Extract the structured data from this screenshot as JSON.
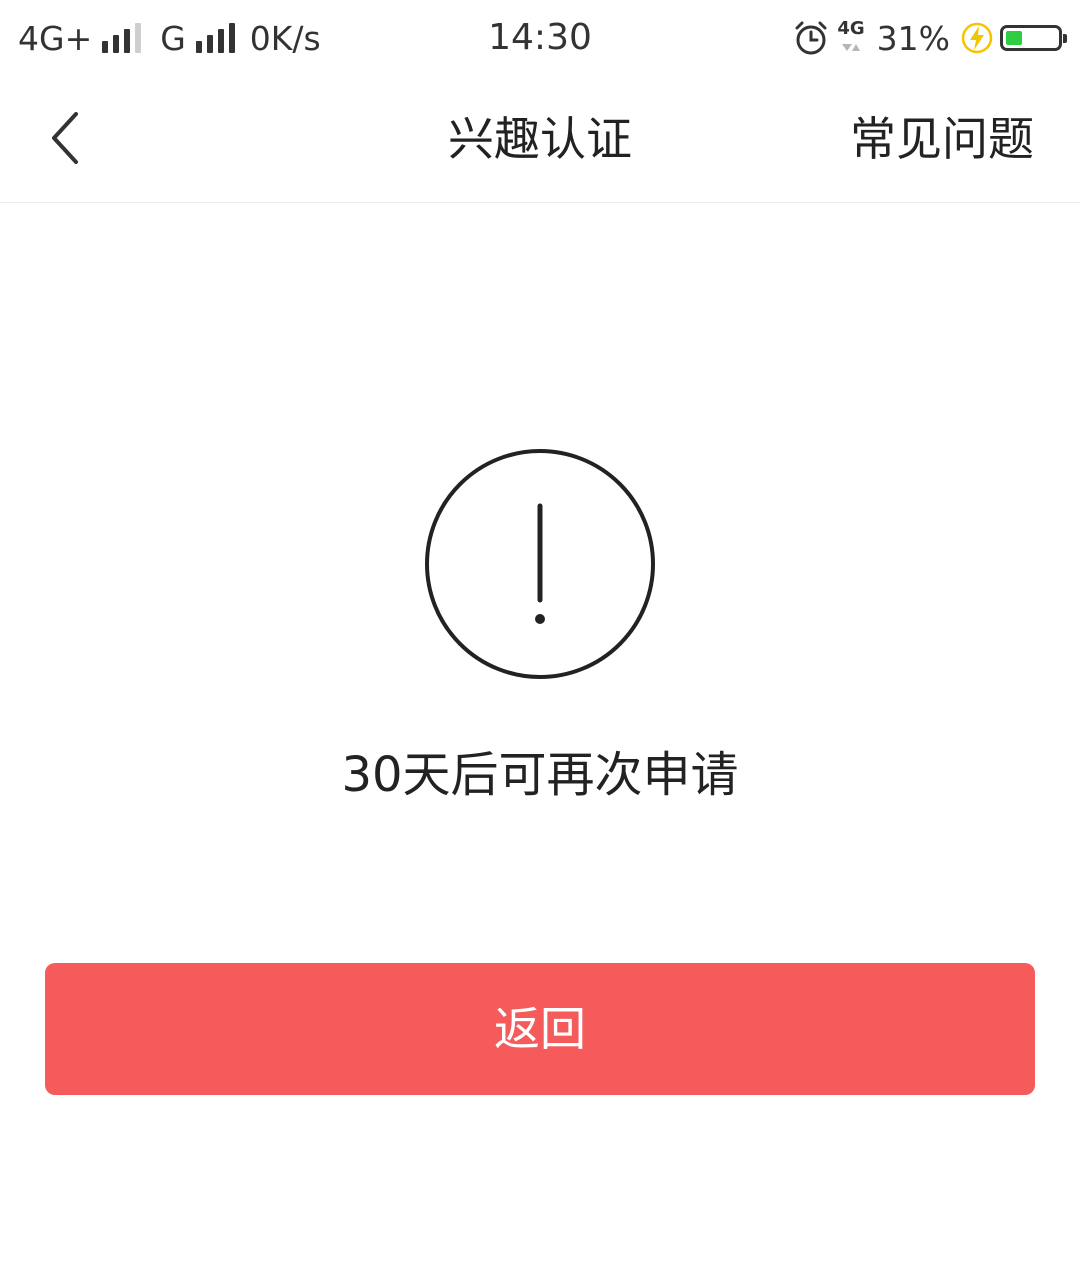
{
  "status_bar": {
    "network_1": "4G+",
    "network_2": "G",
    "speed": "0K/s",
    "time": "14:30",
    "network_mini": "4G",
    "battery_percent": "31%",
    "battery_level": 0.31,
    "battery_fill_color": "#2ecc40",
    "charging_color": "#f5c400",
    "icons": [
      "signal-icon",
      "alarm-icon",
      "charging-icon",
      "battery-icon"
    ]
  },
  "nav": {
    "back_icon": "chevron-left-icon",
    "title": "兴趣认证",
    "faq_label": "常见问题"
  },
  "main": {
    "icon": "exclamation-circle-icon",
    "message": "30天后可再次申请",
    "button_label": "返回",
    "accent_color": "#f65b5b"
  }
}
